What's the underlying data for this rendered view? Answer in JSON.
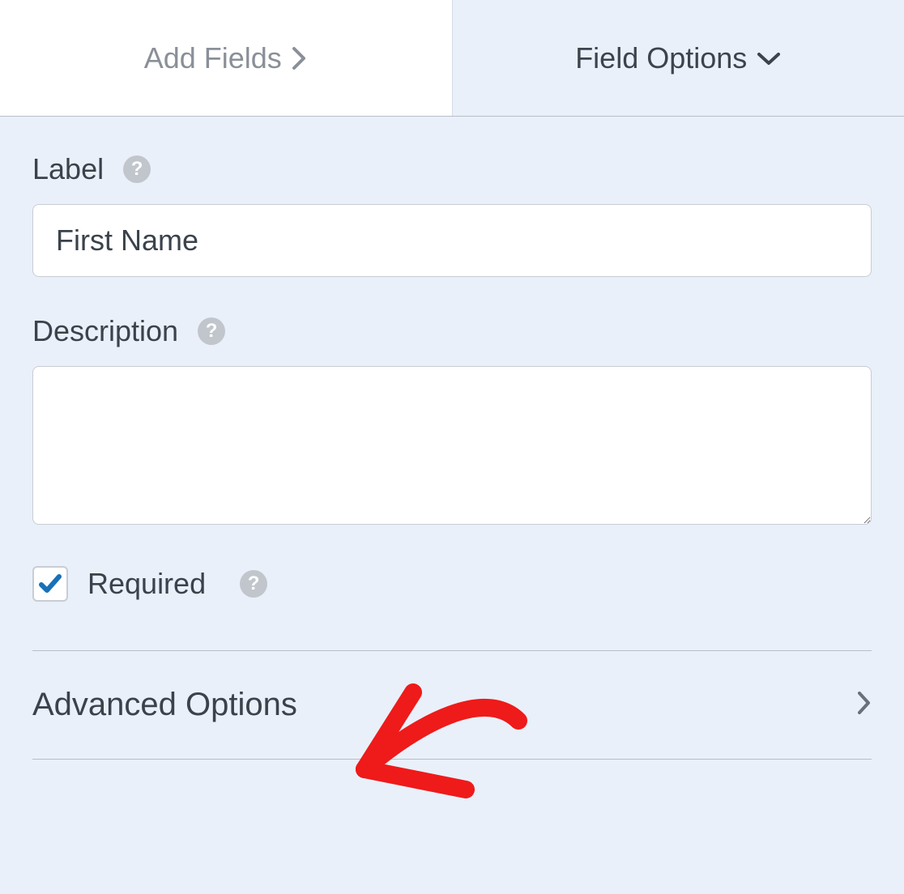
{
  "tabs": {
    "add_fields": "Add Fields",
    "field_options": "Field Options"
  },
  "fields": {
    "label_heading": "Label",
    "label_value": "First Name",
    "description_heading": "Description",
    "description_value": "",
    "required_label": "Required",
    "required_checked": true
  },
  "sections": {
    "advanced_options": "Advanced Options"
  }
}
